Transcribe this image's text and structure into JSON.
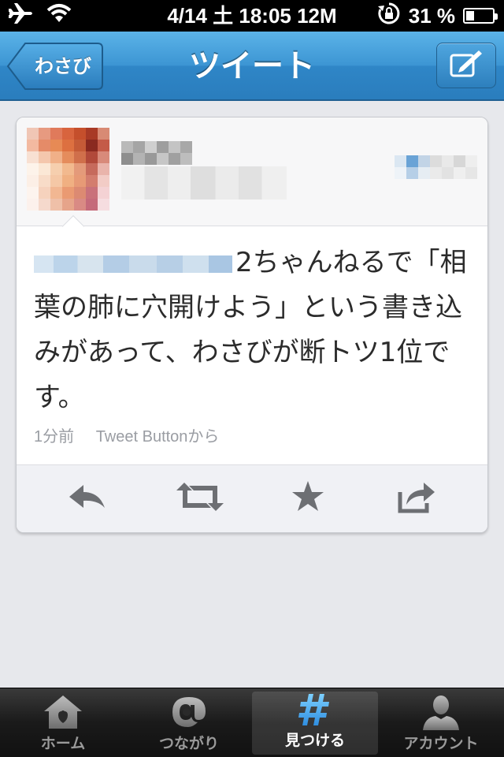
{
  "status_bar": {
    "carrier_icon": "airplane-icon",
    "wifi_icon": "wifi-icon",
    "time": "4/14 土 18:05 12M",
    "rotation_lock_icon": "rotation-lock-icon",
    "battery_text": "31 %",
    "battery_level": 0.31
  },
  "nav": {
    "back_label": "わさび",
    "title": "ツイート",
    "compose_icon": "compose-icon"
  },
  "tweet": {
    "text_after_mention": "2ちゃんねるで「相葉の肺に穴開けよう」という書き込みがあって、わさびが断トツ1位です。",
    "time_ago": "1分前",
    "source": "Tweet Buttonから"
  },
  "actions": [
    {
      "name": "reply",
      "icon": "reply-icon"
    },
    {
      "name": "retweet",
      "icon": "retweet-icon"
    },
    {
      "name": "favorite",
      "icon": "star-icon"
    },
    {
      "name": "share",
      "icon": "share-icon"
    }
  ],
  "tabs": [
    {
      "label": "ホーム",
      "icon": "home-icon",
      "active": false
    },
    {
      "label": "つながり",
      "icon": "at-icon",
      "active": false
    },
    {
      "label": "見つける",
      "icon": "hash-icon",
      "active": true
    },
    {
      "label": "アカウント",
      "icon": "person-icon",
      "active": false
    }
  ],
  "colors": {
    "nav_blue": "#3c95d3",
    "tweet_text": "#2b2b2b",
    "meta_gray": "#9a9da3",
    "hash_active": "#3aa0e8"
  }
}
